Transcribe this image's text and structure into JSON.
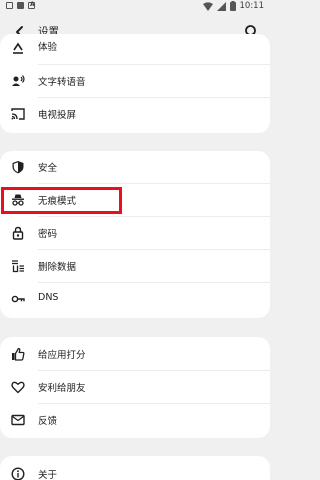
{
  "status_bar": {
    "time": "10:11"
  },
  "app_bar": {
    "title": "设置"
  },
  "groups": [
    {
      "items": [
        {
          "label": "体验",
          "icon": "mascot-icon"
        },
        {
          "label": "文字转语音",
          "icon": "speech-icon"
        },
        {
          "label": "电视投屏",
          "icon": "cast-icon"
        }
      ]
    },
    {
      "items": [
        {
          "label": "安全",
          "icon": "shield-icon"
        },
        {
          "label": "无痕模式",
          "icon": "incognito-icon"
        },
        {
          "label": "密码",
          "icon": "lock-icon"
        },
        {
          "label": "删除数据",
          "icon": "delete-data-icon"
        },
        {
          "label": "DNS",
          "icon": "key-icon"
        }
      ]
    },
    {
      "items": [
        {
          "label": "给应用打分",
          "icon": "thumbs-up-icon"
        },
        {
          "label": "安利给朋友",
          "icon": "heart-icon"
        },
        {
          "label": "反馈",
          "icon": "mail-icon"
        }
      ]
    },
    {
      "items": [
        {
          "label": "关于",
          "icon": "info-icon"
        }
      ]
    }
  ],
  "highlight_color": "#e8101c"
}
